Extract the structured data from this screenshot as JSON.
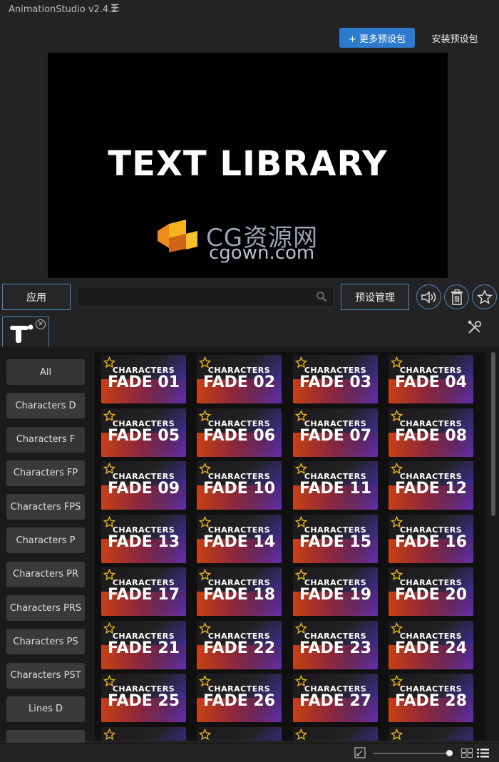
{
  "app": {
    "title": "AnimationStudio v2.4.2",
    "menu_icon": "hamburger-icon"
  },
  "header": {
    "more_presets_label": "+ 更多预设包",
    "install_presets_label": "安装预设包"
  },
  "preview": {
    "title": "TEXT LIBRARY",
    "watermark_line1": "CG资源网",
    "watermark_line2": "cgown.com"
  },
  "toolbar": {
    "apply_label": "应用",
    "search_value": "",
    "search_placeholder": "",
    "manage_label": "预设管理",
    "icons": [
      "search-icon",
      "speaker-icon",
      "trash-icon",
      "star-icon"
    ]
  },
  "tabs": {
    "active_tab_icon": "text-type-icon",
    "close_icon": "close-icon",
    "tools_icon": "wrench-screwdriver-icon"
  },
  "sidebar": {
    "categories": [
      {
        "label": "All"
      },
      {
        "label": "Characters D"
      },
      {
        "label": "Characters F"
      },
      {
        "label": "Characters FP"
      },
      {
        "label": "Characters FPS"
      },
      {
        "label": "Characters P"
      },
      {
        "label": "Characters PR"
      },
      {
        "label": "Characters PRS"
      },
      {
        "label": "Characters PS"
      },
      {
        "label": "Characters PST"
      },
      {
        "label": "Lines D"
      },
      {
        "label": ""
      }
    ]
  },
  "presets": {
    "line1": "CHARACTERS",
    "items": [
      "FADE 01",
      "FADE 02",
      "FADE 03",
      "FADE 04",
      "FADE 05",
      "FADE 06",
      "FADE 07",
      "FADE 08",
      "FADE 09",
      "FADE 10",
      "FADE 11",
      "FADE 12",
      "FADE 13",
      "FADE 14",
      "FADE 15",
      "FADE 16",
      "FADE 17",
      "FADE 18",
      "FADE 19",
      "FADE 20",
      "FADE 21",
      "FADE 22",
      "FADE 23",
      "FADE 24",
      "FADE 25",
      "FADE 26",
      "FADE 27",
      "FADE 28",
      "",
      "",
      "",
      ""
    ]
  },
  "footer": {
    "zoom_fraction": 0.97,
    "icons": [
      "fit-icon",
      "grid-view-icon",
      "list-view-icon"
    ]
  },
  "colors": {
    "accent": "#2d7bcf",
    "border_blue": "#4b86bf",
    "star_gold": "#e3b020"
  }
}
